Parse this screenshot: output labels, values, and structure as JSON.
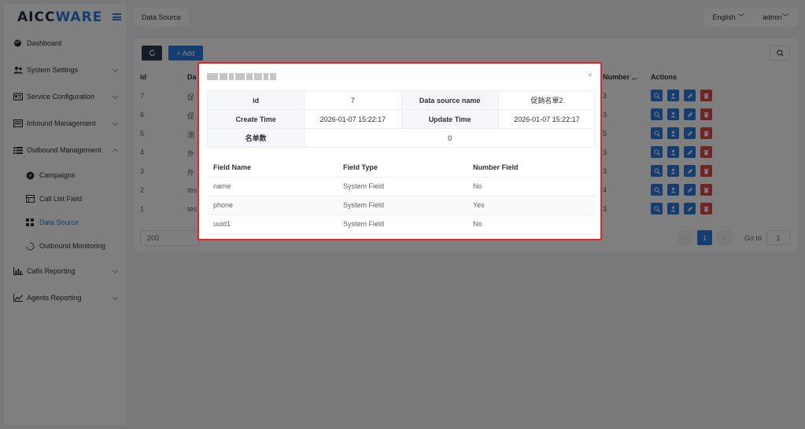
{
  "brand": {
    "logo_main": "AICC",
    "logo_accent": "WARE"
  },
  "sidebar": {
    "items": [
      {
        "label": "Dashboard",
        "icon": "palette-icon"
      },
      {
        "label": "System Settings",
        "icon": "users-cog-icon"
      },
      {
        "label": "Service Configuration",
        "icon": "id-card-icon"
      },
      {
        "label": "Inbound Management",
        "icon": "list-icon"
      },
      {
        "label": "Outbound Management",
        "icon": "list-icon"
      },
      {
        "label": "Campaigns",
        "icon": "compass-icon"
      },
      {
        "label": "Call List Field",
        "icon": "table-icon"
      },
      {
        "label": "Data Source",
        "icon": "grid-icon"
      },
      {
        "label": "Outbound Monitoring",
        "icon": "refresh-icon"
      },
      {
        "label": "Calls Reporting",
        "icon": "bar-chart-icon"
      },
      {
        "label": "Agents Reporting",
        "icon": "line-chart-icon"
      }
    ]
  },
  "topbar": {
    "tab": "Data Source",
    "language": "English",
    "user": "admin"
  },
  "toolbar": {
    "add_label": "+ Add"
  },
  "table": {
    "headers": {
      "id": "id",
      "data": "Da",
      "number": "Number ...",
      "actions": "Actions"
    },
    "rows": [
      {
        "id": "7",
        "data": "促",
        "number": "3"
      },
      {
        "id": "6",
        "data": "促",
        "number": "3"
      },
      {
        "id": "5",
        "data": "测",
        "number": "5"
      },
      {
        "id": "4",
        "data": "外",
        "number": "3"
      },
      {
        "id": "3",
        "data": "外",
        "number": "3"
      },
      {
        "id": "2",
        "data": "tes",
        "number": "4"
      },
      {
        "id": "1",
        "data": "tes",
        "number": "3"
      }
    ]
  },
  "pagination": {
    "page_size": "200",
    "current_page": "1",
    "goto_label": "Go to",
    "goto_value": "1"
  },
  "dialog": {
    "close": "×",
    "details": {
      "id_label": "id",
      "id_value": "7",
      "name_label": "Data source name",
      "name_value": "促銷名單2",
      "create_label": "Create Time",
      "create_value": "2026-01-07 15:22:17",
      "update_label": "Update Time",
      "update_value": "2026-01-07 15:22:17",
      "count_label": "名单数",
      "count_value": "0"
    },
    "fields": {
      "headers": [
        "Field Name",
        "Field Type",
        "Number Field"
      ],
      "rows": [
        [
          "name",
          "System Field",
          "No"
        ],
        [
          "phone",
          "System Field",
          "Yes"
        ],
        [
          "uuid1",
          "System Field",
          "No"
        ]
      ]
    }
  }
}
